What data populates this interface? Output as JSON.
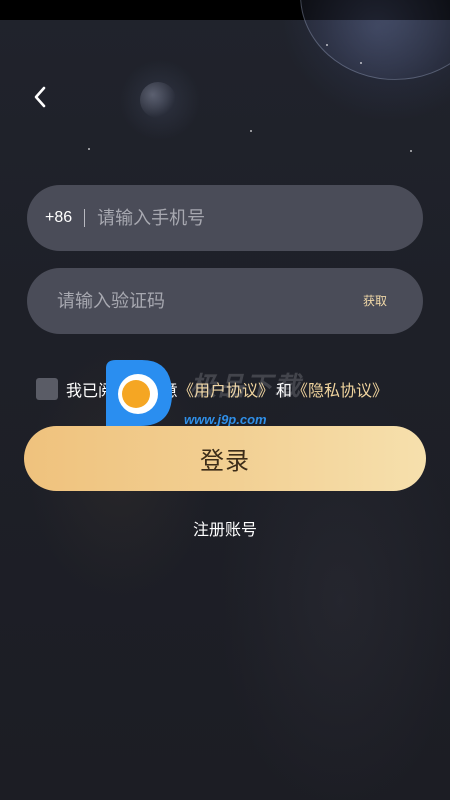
{
  "header": {
    "back_icon": "chevron-left-icon"
  },
  "phone_field": {
    "country_code": "+86",
    "placeholder": "请输入手机号",
    "value": ""
  },
  "code_field": {
    "placeholder": "请输入验证码",
    "value": "",
    "get_code_label": "获取"
  },
  "agreement": {
    "checked": false,
    "prefix": "我已阅读并同意",
    "user_agreement": "《用户协议》",
    "joiner": "和",
    "privacy_policy": "《隐私协议》"
  },
  "login_button": {
    "label": "登录"
  },
  "register_link": {
    "label": "注册账号"
  },
  "watermark": {
    "title": "极品下载",
    "url": "www.j9p.com"
  },
  "colors": {
    "background": "#1f2129",
    "field": "#4a4c58",
    "accent_gold": "#f0d49e",
    "button_gradient_start": "#efc27d",
    "button_gradient_end": "#f6e0ad",
    "button_text": "#3c2c18"
  }
}
